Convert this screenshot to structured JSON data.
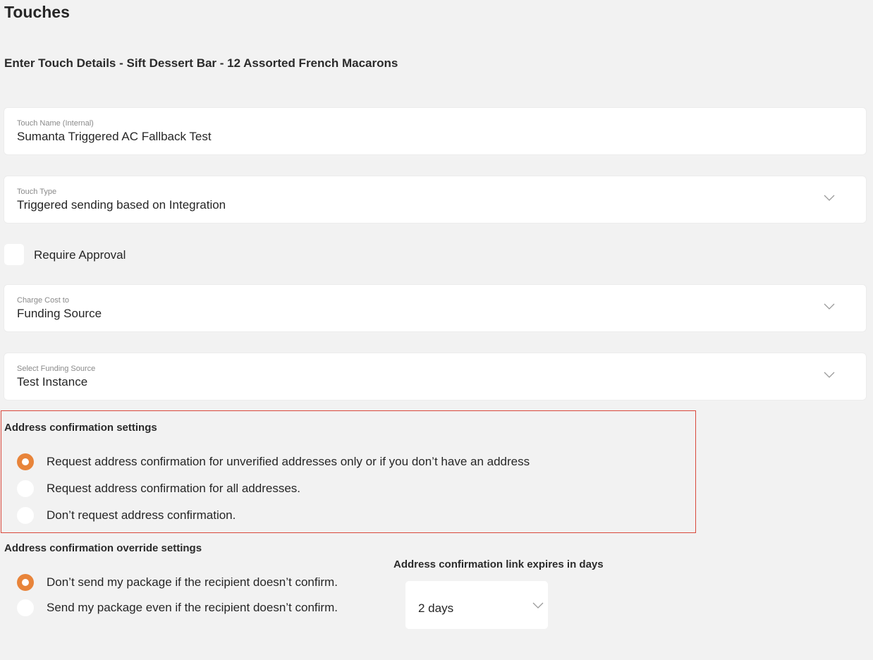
{
  "page_title": "Touches",
  "subtitle": "Enter Touch Details - Sift Dessert Bar - 12 Assorted French Macarons",
  "fields": {
    "touch_name": {
      "label": "Touch Name (Internal)",
      "value": "Sumanta Triggered AC Fallback Test"
    },
    "touch_type": {
      "label": "Touch Type",
      "value": "Triggered sending based on Integration"
    },
    "charge_cost": {
      "label": "Charge Cost to",
      "value": "Funding Source"
    },
    "funding_source": {
      "label": "Select Funding Source",
      "value": "Test Instance"
    }
  },
  "require_approval": {
    "label": "Require Approval",
    "checked": false
  },
  "address_confirmation": {
    "title": "Address confirmation settings",
    "options": [
      {
        "label": "Request address confirmation for unverified addresses only or if you don’t have an address",
        "selected": true
      },
      {
        "label": "Request address confirmation for all addresses.",
        "selected": false
      },
      {
        "label": "Don’t request address confirmation.",
        "selected": false
      }
    ]
  },
  "override": {
    "title": "Address confirmation override settings",
    "options": [
      {
        "label": "Don’t send my package if the recipient doesn’t confirm.",
        "selected": true
      },
      {
        "label": "Send my package even if the recipient doesn’t confirm.",
        "selected": false
      }
    ]
  },
  "expiry": {
    "title": "Address confirmation link expires in days",
    "value": "2 days"
  },
  "colors": {
    "accent": "#e8843a",
    "highlight_border": "#d9483b",
    "background": "#f2f2f2"
  },
  "icons": {
    "dropdown": "chevron-down-icon"
  }
}
